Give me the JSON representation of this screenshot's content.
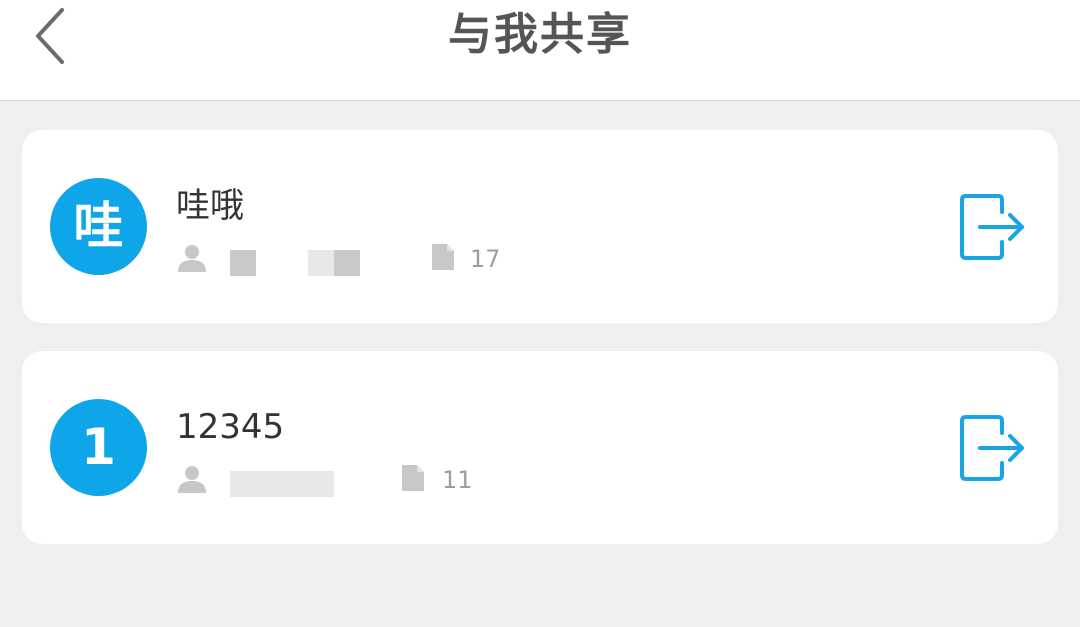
{
  "header": {
    "title": "与我共享"
  },
  "theme": {
    "accent": "#1aa3e5",
    "avatar_bg": "#0ea5e9",
    "icon_gray": "#c7c7c7"
  },
  "shares": [
    {
      "avatar_text": "哇",
      "name": "哇哦",
      "file_count": "17"
    },
    {
      "avatar_text": "1",
      "name": "12345",
      "file_count": "11"
    }
  ]
}
